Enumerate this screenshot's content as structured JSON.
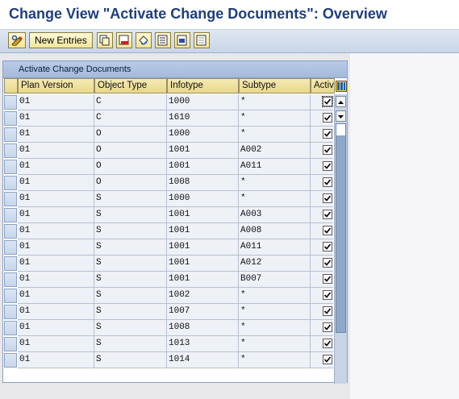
{
  "window": {
    "title": "Change View \"Activate Change Documents\": Overview"
  },
  "toolbar": {
    "new_entries_label": "New Entries",
    "icons": [
      "display-change-icon",
      "copy-icon",
      "delete-icon",
      "undo-icon",
      "select-all-icon",
      "select-block-icon",
      "deselect-all-icon"
    ]
  },
  "table": {
    "title": "Activate Change Documents",
    "columns": [
      "Plan Version",
      "Object Type",
      "Infotype",
      "Subtype",
      "Activ"
    ],
    "rows": [
      {
        "plan": "01",
        "otype": "C",
        "infotype": "1000",
        "subtype": "*",
        "active": true
      },
      {
        "plan": "01",
        "otype": "C",
        "infotype": "1610",
        "subtype": "*",
        "active": true
      },
      {
        "plan": "01",
        "otype": "O",
        "infotype": "1000",
        "subtype": "*",
        "active": true
      },
      {
        "plan": "01",
        "otype": "O",
        "infotype": "1001",
        "subtype": "A002",
        "active": true
      },
      {
        "plan": "01",
        "otype": "O",
        "infotype": "1001",
        "subtype": "A011",
        "active": true
      },
      {
        "plan": "01",
        "otype": "O",
        "infotype": "1008",
        "subtype": "*",
        "active": true
      },
      {
        "plan": "01",
        "otype": "S",
        "infotype": "1000",
        "subtype": "*",
        "active": true
      },
      {
        "plan": "01",
        "otype": "S",
        "infotype": "1001",
        "subtype": "A003",
        "active": true
      },
      {
        "plan": "01",
        "otype": "S",
        "infotype": "1001",
        "subtype": "A008",
        "active": true
      },
      {
        "plan": "01",
        "otype": "S",
        "infotype": "1001",
        "subtype": "A011",
        "active": true
      },
      {
        "plan": "01",
        "otype": "S",
        "infotype": "1001",
        "subtype": "A012",
        "active": true
      },
      {
        "plan": "01",
        "otype": "S",
        "infotype": "1001",
        "subtype": "B007",
        "active": true
      },
      {
        "plan": "01",
        "otype": "S",
        "infotype": "1002",
        "subtype": "*",
        "active": true
      },
      {
        "plan": "01",
        "otype": "S",
        "infotype": "1007",
        "subtype": "*",
        "active": true
      },
      {
        "plan": "01",
        "otype": "S",
        "infotype": "1008",
        "subtype": "*",
        "active": true
      },
      {
        "plan": "01",
        "otype": "S",
        "infotype": "1013",
        "subtype": "*",
        "active": true
      },
      {
        "plan": "01",
        "otype": "S",
        "infotype": "1014",
        "subtype": "*",
        "active": true
      }
    ]
  }
}
